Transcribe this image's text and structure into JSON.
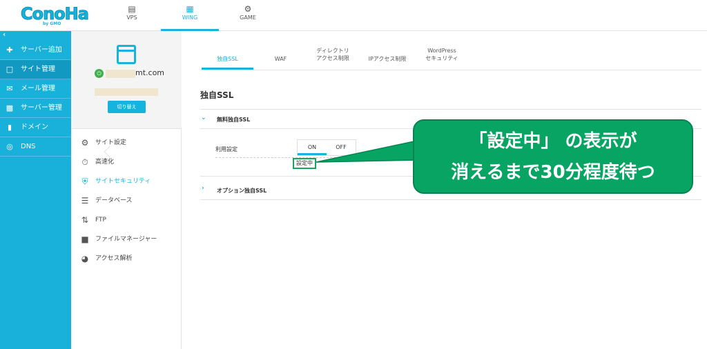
{
  "brand": {
    "logo_text": "ConoHa",
    "logo_sub": "by GMO"
  },
  "top_tabs": [
    {
      "label": "VPS",
      "icon": "server-icon"
    },
    {
      "label": "WING",
      "icon": "building-icon",
      "active": true
    },
    {
      "label": "GAME",
      "icon": "gamepad-icon"
    }
  ],
  "sidebar": {
    "collapse_icon": "chevron-left-icon",
    "items": [
      {
        "label": "サーバー追加",
        "icon": "plus-icon"
      },
      {
        "label": "サイト管理",
        "icon": "window-icon",
        "active": true
      },
      {
        "label": "メール管理",
        "icon": "mail-icon"
      },
      {
        "label": "サーバー管理",
        "icon": "server-manage-icon"
      },
      {
        "label": "ドメイン",
        "icon": "domain-icon"
      },
      {
        "label": "DNS",
        "icon": "globe-icon"
      }
    ]
  },
  "site": {
    "domain_suffix": "mt.com",
    "switch_label": "切り替え"
  },
  "site_menu": [
    {
      "label": "サイト設定",
      "icon": "settings-icon"
    },
    {
      "label": "高速化",
      "icon": "stopwatch-icon"
    },
    {
      "label": "サイトセキュリティ",
      "icon": "shield-icon",
      "active": true
    },
    {
      "label": "データベース",
      "icon": "database-icon"
    },
    {
      "label": "FTP",
      "icon": "transfer-icon"
    },
    {
      "label": "ファイルマネージャー",
      "icon": "folder-icon"
    },
    {
      "label": "アクセス解析",
      "icon": "pie-chart-icon"
    }
  ],
  "security_tabs": [
    {
      "label": "独自SSL",
      "active": true
    },
    {
      "label": "WAF"
    },
    {
      "label_line1": "ディレクトリ",
      "label_line2": "アクセス制限"
    },
    {
      "label": "IPアクセス制限"
    },
    {
      "label_line1": "WordPress",
      "label_line2": "セキュリティ"
    }
  ],
  "page_title": "独自SSL",
  "free_ssl": {
    "heading": "無料独自SSL",
    "use_label": "利用設定",
    "on_label": "ON",
    "off_label": "OFF",
    "selected": "ON",
    "status": "設定中"
  },
  "option_ssl": {
    "heading": "オプション独自SSL"
  },
  "callout": {
    "line1": "「設定中」 の表示が",
    "line2": "消えるまで30分程度待つ",
    "color": "#07a463"
  },
  "colors": {
    "accent": "#16b3dd",
    "sidebar": "#19b1d9",
    "status_border": "#1aa55f"
  }
}
